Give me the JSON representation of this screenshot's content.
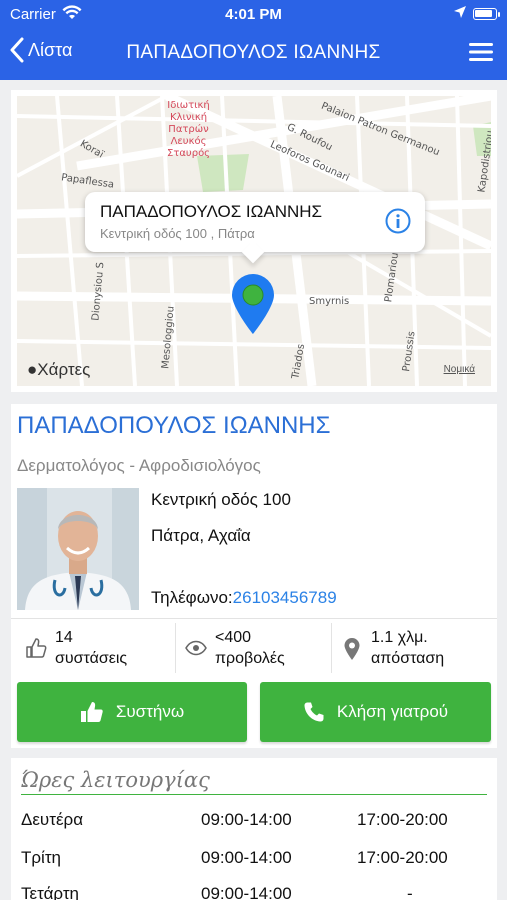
{
  "status_bar": {
    "carrier": "Carrier",
    "time": "4:01 PM",
    "battery_level": 0.9
  },
  "nav": {
    "back_label": "Λίστα",
    "title": "ΠΑΠΑΔΟΠΟΥΛΟΣ ΙΩΑΝΝΗΣ"
  },
  "map": {
    "callout_name": "ΠΑΠΑΔΟΠΟΥΛΟΣ ΙΩΑΝΝΗΣ",
    "callout_address": "Κεντρική οδός 100 , Πάτρα",
    "maps_logo": "Χάρτες",
    "legal": "Νομικά",
    "poi": [
      "Ιδιωτική",
      "Κλινική",
      "Πατρών",
      "Λευκός",
      "Σταυρός"
    ],
    "streets": [
      "Palaion Patron Germanou",
      "Leoforos Gounari",
      "G. Roufou",
      "Koraï",
      "Papaflessa",
      "Dionysiou S",
      "Smyrnis",
      "Triados",
      "Mesologgiou",
      "Plomariou",
      "Proussis",
      "Kapodistriou"
    ]
  },
  "doctor": {
    "name": "ΠΑΠΑΔΟΠΟΥΛΟΣ ΙΩΑΝΝΗΣ",
    "specialty": "Δερματολόγος - Αφροδισιολόγος",
    "address_line1": "Κεντρική οδός 100",
    "address_line2": "Πάτρα, Αχαΐα",
    "phone_label": "Τηλέφωνο:",
    "phone": "26103456789"
  },
  "stats": {
    "recommendations_value": "14",
    "recommendations_label": "συστάσεις",
    "views_value": "<400",
    "views_label": "προβολές",
    "distance_value": "1.1 χλμ.",
    "distance_label": "απόσταση"
  },
  "buttons": {
    "recommend": "Συστήνω",
    "call": "Κλήση γιατρού"
  },
  "colors": {
    "header": "#2b63e6",
    "accent_green": "#3fb33f",
    "link_blue": "#2b6fd6"
  },
  "hours": {
    "title": "Ώρες λειτουργίας",
    "rows": [
      {
        "day": "Δευτέρα",
        "morning": "09:00-14:00",
        "afternoon": "17:00-20:00"
      },
      {
        "day": "Τρίτη",
        "morning": "09:00-14:00",
        "afternoon": "17:00-20:00"
      },
      {
        "day": "Τετάρτη",
        "morning": "09:00-14:00",
        "afternoon": "-"
      }
    ]
  }
}
